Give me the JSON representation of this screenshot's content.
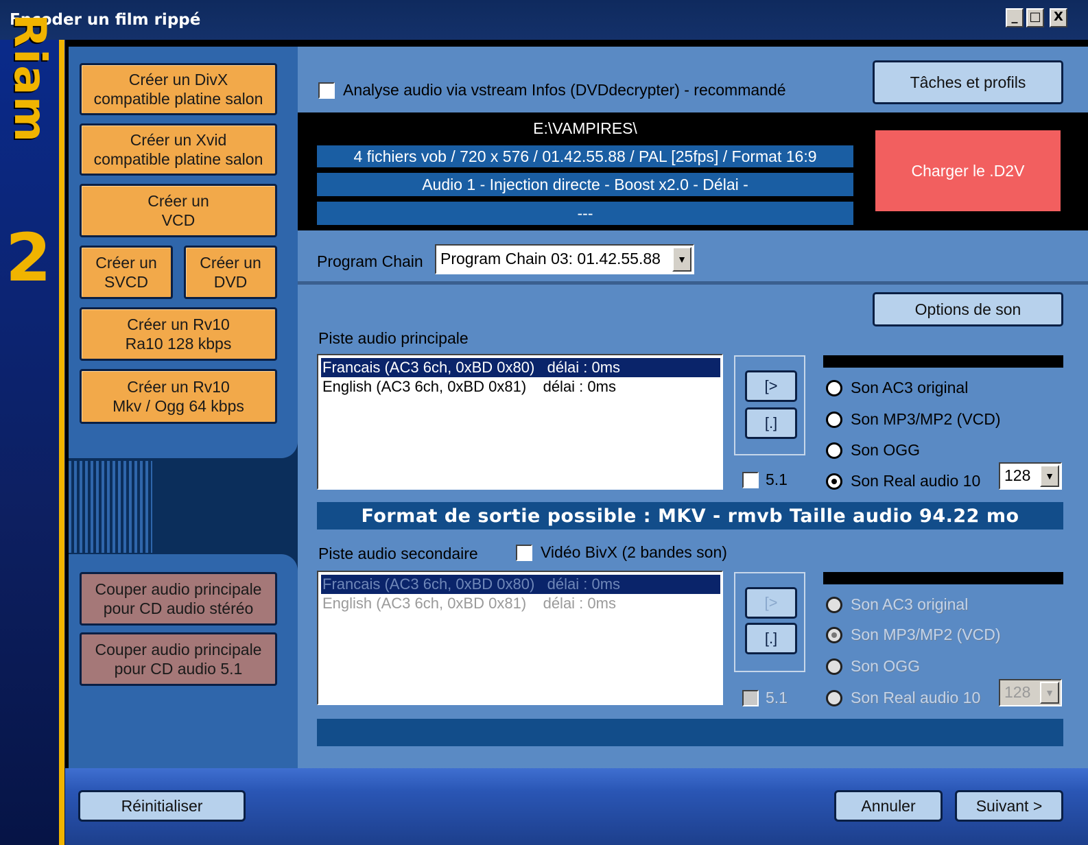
{
  "window": {
    "title": "Encoder un film rippé",
    "minimize": "_",
    "maximize": "□",
    "close": "X"
  },
  "logo": {
    "text": "Riam",
    "number": "2"
  },
  "left_buttons": [
    {
      "label": "Créer un DivX\ncompatible platine salon"
    },
    {
      "label": "Créer un Xvid\ncompatible platine salon"
    },
    {
      "label": "Créer un\nVCD"
    },
    {
      "label": "Créer un\nSVCD"
    },
    {
      "label": "Créer un\nDVD"
    },
    {
      "label": "Créer un Rv10\nRa10 128 kbps"
    },
    {
      "label": "Créer un Rv10\nMkv / Ogg 64 kbps"
    }
  ],
  "cut_buttons": [
    {
      "label": "Couper audio principale\npour CD audio stéréo"
    },
    {
      "label": "Couper audio principale\npour CD audio 5.1"
    }
  ],
  "analyse": {
    "label": "Analyse audio via vstream Infos (DVDdecrypter) - recommandé",
    "checked": false
  },
  "tasks_button": "Tâches et profils",
  "info": {
    "path": "E:\\VAMPIRES\\",
    "video": "4 fichiers vob / 720 x 576 / 01.42.55.88  / PAL [25fps] / Format 16:9",
    "audio": "Audio 1 - Injection directe - Boost  x2.0 - Délai -",
    "extra": "---"
  },
  "load_button": "Charger le .D2V",
  "program_chain": {
    "label": "Program Chain",
    "value": "Program Chain 03:  01.42.55.88"
  },
  "sound_options_button": "Options de son",
  "primary": {
    "label": "Piste audio principale",
    "tracks": [
      "Francais (AC3 6ch, 0xBD 0x80)   délai : 0ms",
      "English (AC3 6ch, 0xBD 0x81)    délai : 0ms"
    ],
    "selected_index": 0,
    "add_button": "[>",
    "clear_button": "[.]",
    "five_one": "5.1",
    "radios": [
      "Son AC3 original",
      "Son MP3/MP2 (VCD)",
      "Son OGG",
      "Son Real audio 10"
    ],
    "selected_radio": 3,
    "bitrate": "128"
  },
  "format_bar": "Format de sortie possible : MKV - rmvb   Taille audio 94.22 mo",
  "secondary": {
    "label": "Piste audio secondaire",
    "bivx_label": "Vidéo BivX (2 bandes son)",
    "tracks": [
      "Francais (AC3 6ch, 0xBD 0x80)   délai : 0ms",
      "English (AC3 6ch, 0xBD 0x81)    délai : 0ms"
    ],
    "add_button": "[>",
    "clear_button": "[.]",
    "five_one": "5.1",
    "radios": [
      "Son AC3 original",
      "Son MP3/MP2 (VCD)",
      "Son OGG",
      "Son Real audio 10"
    ],
    "selected_radio": 1,
    "bitrate": "128"
  },
  "bottom": {
    "reset": "Réinitialiser",
    "cancel": "Annuler",
    "next": "Suivant >"
  }
}
